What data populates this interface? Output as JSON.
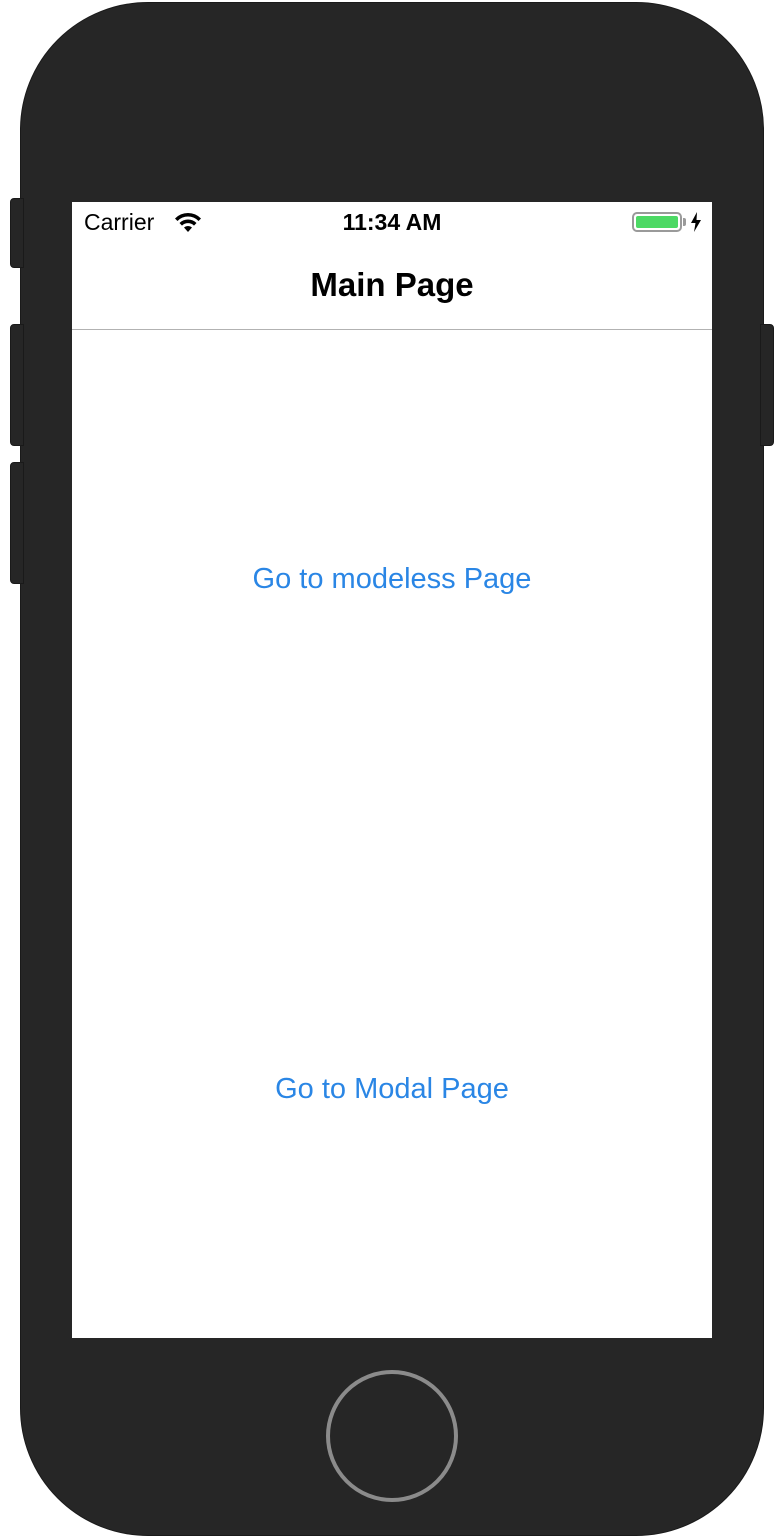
{
  "status_bar": {
    "carrier": "Carrier",
    "time": "11:34 AM",
    "wifi_icon": "wifi-icon",
    "battery_icon": "battery-charging-icon",
    "battery_color": "#4cd964",
    "battery_level": 1.0
  },
  "nav": {
    "title": "Main Page"
  },
  "main": {
    "modeless_button_label": "Go to modeless Page",
    "modal_button_label": "Go to Modal Page"
  },
  "colors": {
    "link": "#2a86e5",
    "device": "#262626"
  }
}
